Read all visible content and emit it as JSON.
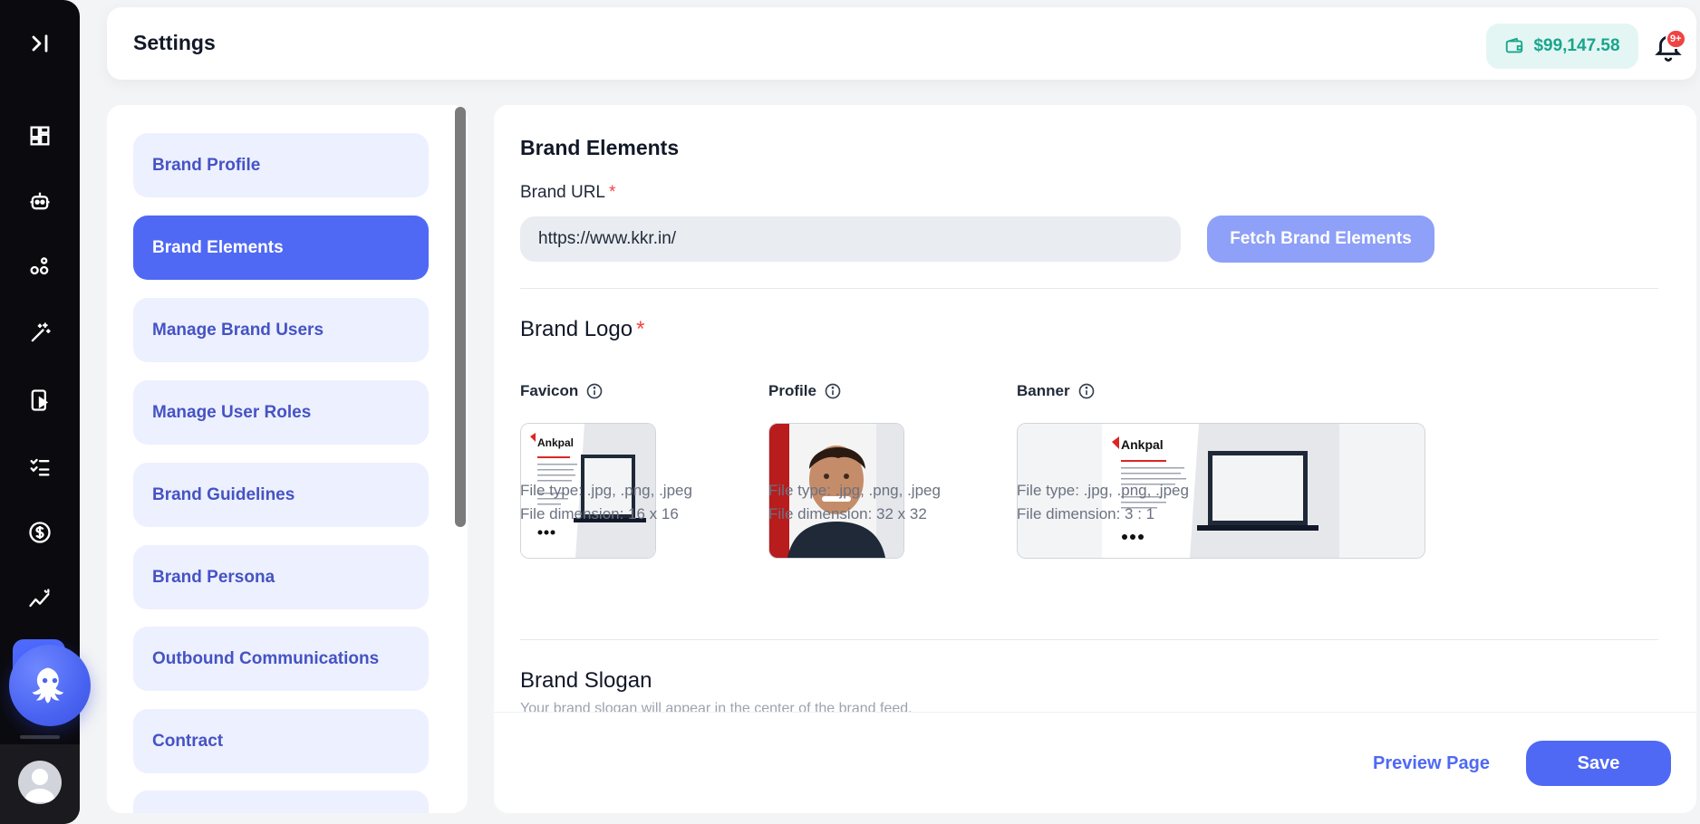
{
  "header": {
    "title": "Settings",
    "balance": "$99,147.58",
    "notification_badge": "9+"
  },
  "rail": {
    "icons": [
      "expand-sidebar-icon",
      "dashboard-icon",
      "robot-icon",
      "nodes-icon",
      "magic-wand-icon",
      "mobile-play-icon",
      "checklist-icon",
      "dollar-icon",
      "analytics-icon"
    ]
  },
  "nav": {
    "items": [
      {
        "label": "Brand Profile",
        "active": false
      },
      {
        "label": "Brand Elements",
        "active": true
      },
      {
        "label": "Manage Brand Users",
        "active": false
      },
      {
        "label": "Manage User Roles",
        "active": false
      },
      {
        "label": "Brand Guidelines",
        "active": false
      },
      {
        "label": "Brand Persona",
        "active": false
      },
      {
        "label": "Outbound Communications",
        "active": false
      },
      {
        "label": "Contract",
        "active": false
      },
      {
        "label": "",
        "active": false
      }
    ]
  },
  "main": {
    "section_title": "Brand Elements",
    "brand_url": {
      "label": "Brand URL",
      "required_mark": "*",
      "value": "https://www.kkr.in/"
    },
    "fetch_button": "Fetch Brand Elements",
    "brand_logo": {
      "title": "Brand Logo",
      "required_mark": "*",
      "favicon": {
        "label": "Favicon",
        "file_type": "File type: .jpg, .png, .jpeg",
        "file_dimension": "File dimension: 16 x 16"
      },
      "profile": {
        "label": "Profile",
        "file_type": "File type: .jpg, .png, .jpeg",
        "file_dimension": "File dimension: 32 x 32"
      },
      "banner": {
        "label": "Banner",
        "file_type": "File type: .jpg, .png, .jpeg",
        "file_dimension": "File dimension: 3 : 1"
      },
      "logo_wordmark": "Ankpal"
    },
    "brand_slogan": {
      "title": "Brand Slogan",
      "description": "Your brand slogan will appear in the center of the brand feed."
    },
    "preview_link": "Preview Page",
    "save_button": "Save"
  },
  "colors": {
    "accent": "#4f69f5",
    "nav_item_bg": "#edf0fe",
    "balance_text": "#19a58d",
    "required": "#ef4444"
  }
}
